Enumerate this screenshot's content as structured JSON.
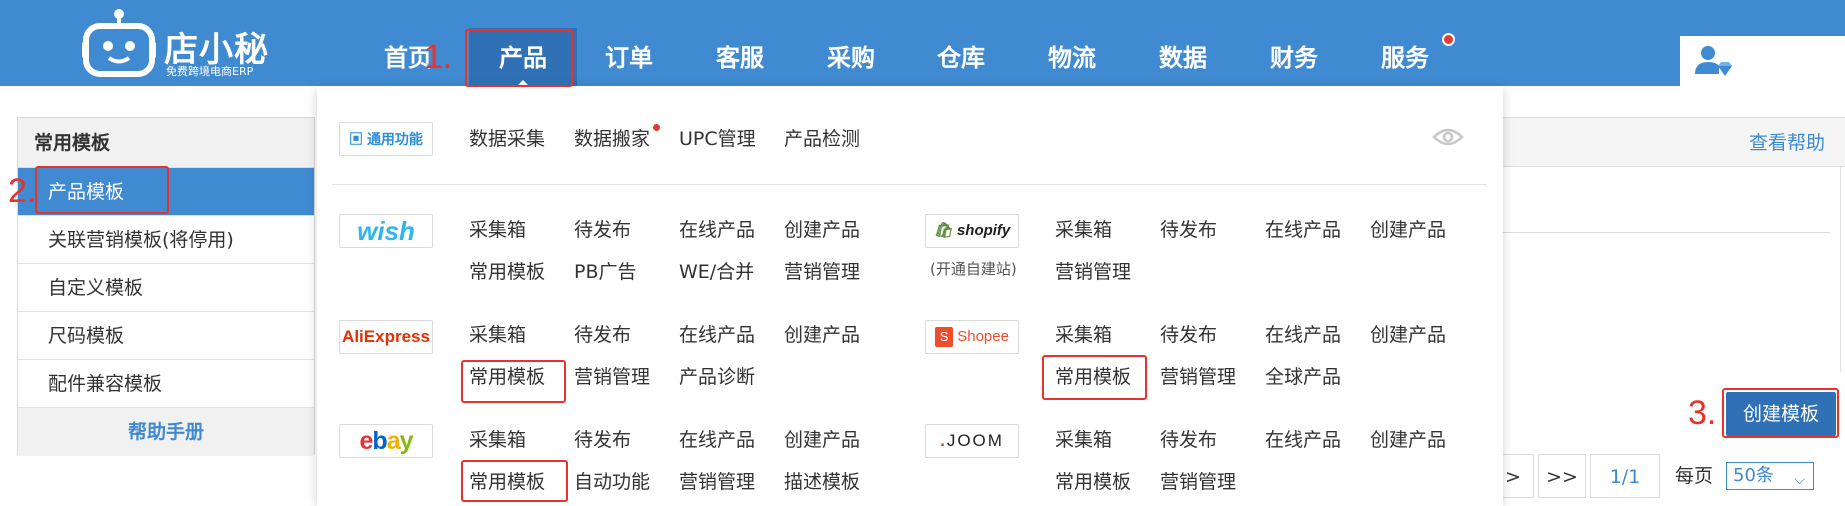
{
  "header": {
    "logo_title": "店小秘",
    "logo_subtitle": "免费跨境电商ERP",
    "nav": [
      {
        "label": "首页"
      },
      {
        "label": "产品"
      },
      {
        "label": "订单"
      },
      {
        "label": "客服"
      },
      {
        "label": "采购"
      },
      {
        "label": "仓库"
      },
      {
        "label": "物流"
      },
      {
        "label": "数据"
      },
      {
        "label": "财务"
      },
      {
        "label": "服务"
      }
    ],
    "active_nav": "产品"
  },
  "annotations": [
    "1.",
    "2.",
    "3."
  ],
  "sidebar": {
    "title": "常用模板",
    "items": [
      {
        "label": "产品模板"
      },
      {
        "label": "关联营销模板(将停用)"
      },
      {
        "label": "自定义模板"
      },
      {
        "label": "尺码模板"
      },
      {
        "label": "配件兼容模板"
      }
    ],
    "help": "帮助手册"
  },
  "main": {
    "help_link": "查看帮助",
    "create_button": "创建模板",
    "pagination": {
      "next": ">",
      "last": ">>",
      "page": "1/1",
      "per_page_label": "每页",
      "per_page_value": "50条"
    }
  },
  "dropdown": {
    "general": {
      "badge": "通用功能",
      "links": [
        "数据采集",
        "数据搬家",
        "UPC管理",
        "产品检测"
      ]
    },
    "platforms": {
      "wish": {
        "badge": "wish",
        "links": [
          "采集箱",
          "待发布",
          "在线产品",
          "创建产品",
          "常用模板",
          "PB广告",
          "WE/合并",
          "营销管理"
        ]
      },
      "shopify": {
        "badge": "shopify",
        "note": "(开通自建站)",
        "links": [
          "采集箱",
          "待发布",
          "在线产品",
          "创建产品",
          "营销管理"
        ]
      },
      "aliexpress": {
        "badge": "AliExpress",
        "links": [
          "采集箱",
          "待发布",
          "在线产品",
          "创建产品",
          "常用模板",
          "营销管理",
          "产品诊断"
        ]
      },
      "shopee": {
        "badge": "Shopee",
        "links": [
          "采集箱",
          "待发布",
          "在线产品",
          "创建产品",
          "常用模板",
          "营销管理",
          "全球产品"
        ]
      },
      "ebay": {
        "badge": "ebay",
        "links": [
          "采集箱",
          "待发布",
          "在线产品",
          "创建产品",
          "常用模板",
          "自动功能",
          "营销管理",
          "描述模板"
        ]
      },
      "joom": {
        "badge": "JOOM",
        "links": [
          "采集箱",
          "待发布",
          "在线产品",
          "创建产品",
          "常用模板",
          "营销管理"
        ]
      }
    }
  },
  "colors": {
    "primary": "#3f8ad0",
    "primary_dark": "#2f71b4",
    "annotation": "#e8322b",
    "ebay_red": "#e53238",
    "ebay_blue": "#0064d2",
    "ebay_yellow": "#f5af02",
    "ebay_green": "#86b817"
  }
}
